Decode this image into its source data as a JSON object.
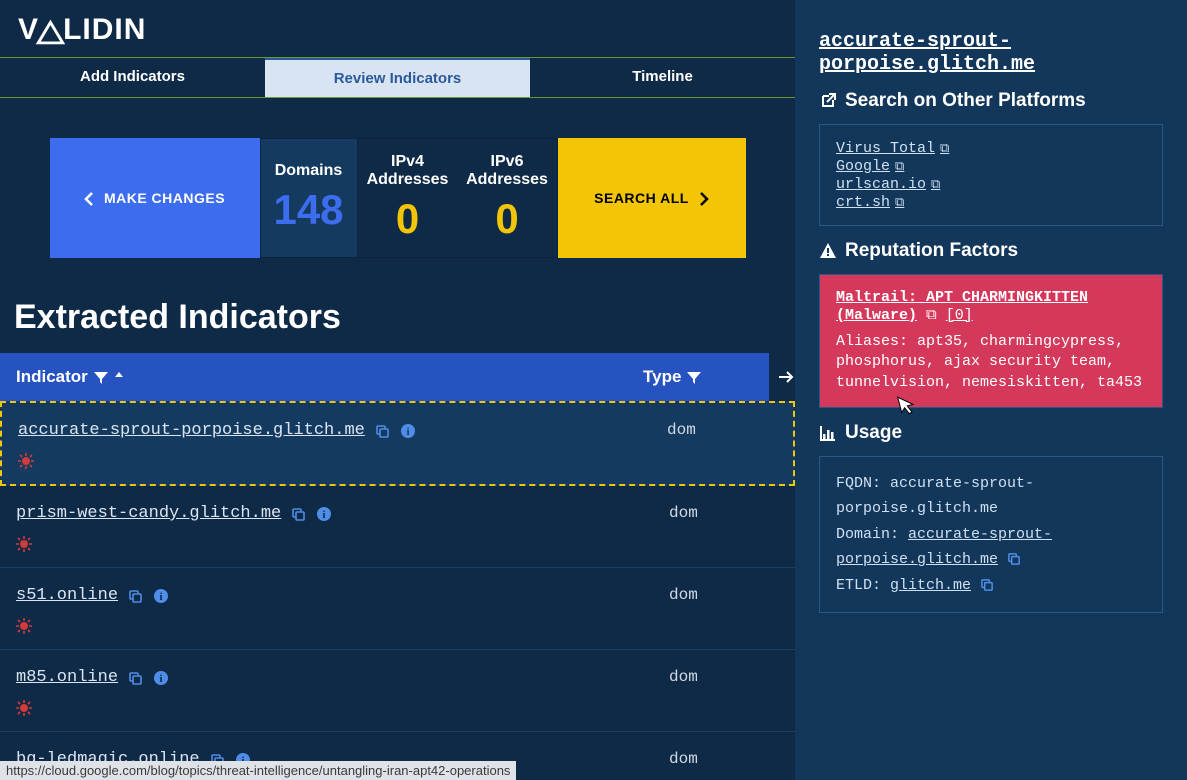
{
  "logo_text": "VALIDIN",
  "tabs": {
    "add": "Add Indicators",
    "review": "Review Indicators",
    "timeline": "Timeline"
  },
  "stats": {
    "make_changes": "MAKE CHANGES",
    "domains_label": "Domains",
    "domains_count": "148",
    "ipv4_label": "IPv4 Addresses",
    "ipv4_count": "0",
    "ipv6_label": "IPv6 Addresses",
    "ipv6_count": "0",
    "search_all": "SEARCH ALL"
  },
  "extracted_title": "Extracted Indicators",
  "table": {
    "col_indicator": "Indicator",
    "col_type": "Type",
    "rows": [
      {
        "indicator": "accurate-sprout-porpoise.glitch.me",
        "type": "dom",
        "threat": true
      },
      {
        "indicator": "prism-west-candy.glitch.me",
        "type": "dom",
        "threat": true
      },
      {
        "indicator": "s51.online",
        "type": "dom",
        "threat": true
      },
      {
        "indicator": "m85.online",
        "type": "dom",
        "threat": true
      },
      {
        "indicator": "bg-ledmagic.online",
        "type": "dom",
        "threat": false
      }
    ]
  },
  "panel": {
    "title": "accurate-sprout-porpoise.glitch.me",
    "search_other": "Search on Other Platforms",
    "platforms": [
      "Virus Total",
      "Google",
      "urlscan.io",
      "crt.sh"
    ],
    "reputation_title": "Reputation Factors",
    "rep_link": "Maltrail: APT CHARMINGKITTEN (Malware)",
    "rep_count": "[0]",
    "rep_aliases_label": "Aliases:",
    "rep_aliases": "apt35, charmingcypress, phosphorus, ajax security team, tunnelvision, nemesiskitten, ta453",
    "usage_title": "Usage",
    "usage_fqdn_label": "FQDN:",
    "usage_fqdn": "accurate-sprout-porpoise.glitch.me",
    "usage_domain_label": "Domain:",
    "usage_domain": "accurate-sprout-porpoise.glitch.me",
    "usage_etld_label": "ETLD:",
    "usage_etld": "glitch.me"
  },
  "status_url": "https://cloud.google.com/blog/topics/threat-intelligence/untangling-iran-apt42-operations"
}
